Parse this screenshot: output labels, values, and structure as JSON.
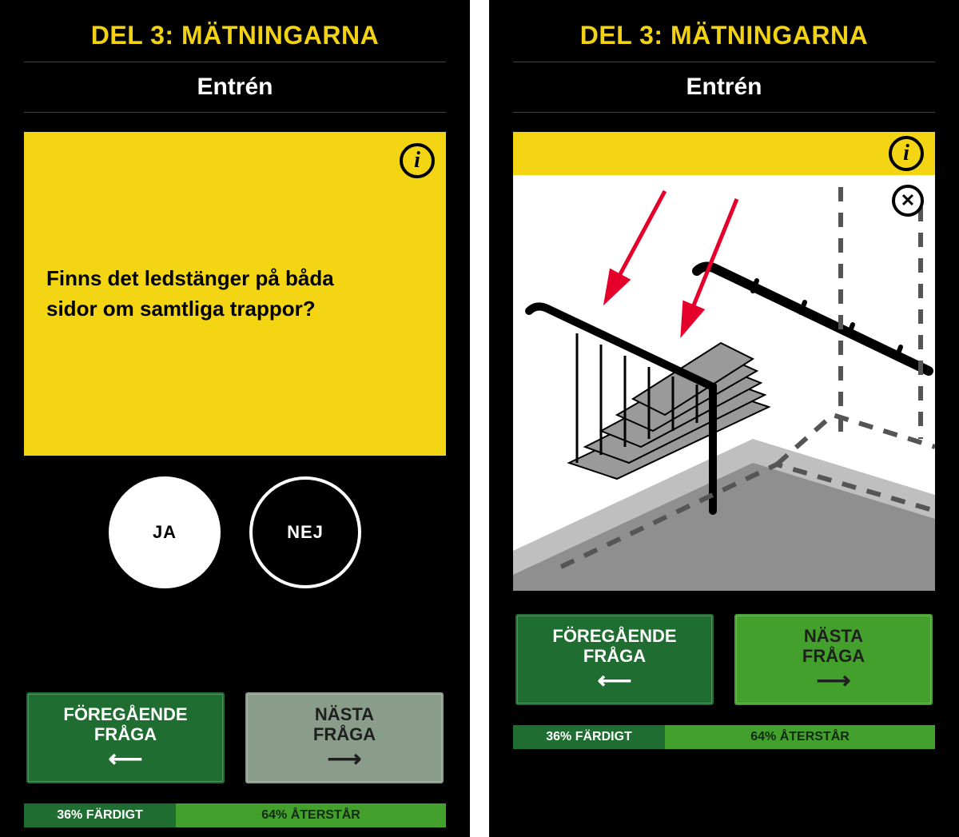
{
  "header": {
    "section_title": "DEL 3: MÄTNINGARNA",
    "subsection": "Entrén"
  },
  "question": {
    "text": "Finns det ledstänger på båda sidor om samtliga trappor?",
    "info_icon_label": "i",
    "close_icon_label": "✕"
  },
  "answers": {
    "yes": "JA",
    "no": "NEJ"
  },
  "nav": {
    "prev_line1": "FÖREGÅENDE",
    "prev_line2": "FRÅGA",
    "next_line1": "NÄSTA",
    "next_line2": "FRÅGA"
  },
  "progress": {
    "done_percent": 36,
    "done_label": "36% FÄRDIGT",
    "remaining_percent": 64,
    "remaining_label": "64% ÅTERSTÅR"
  },
  "colors": {
    "accent_yellow": "#f3d514",
    "dark_green": "#1f6d31",
    "bright_green": "#43a02c",
    "muted_green": "#8a9c8a"
  }
}
